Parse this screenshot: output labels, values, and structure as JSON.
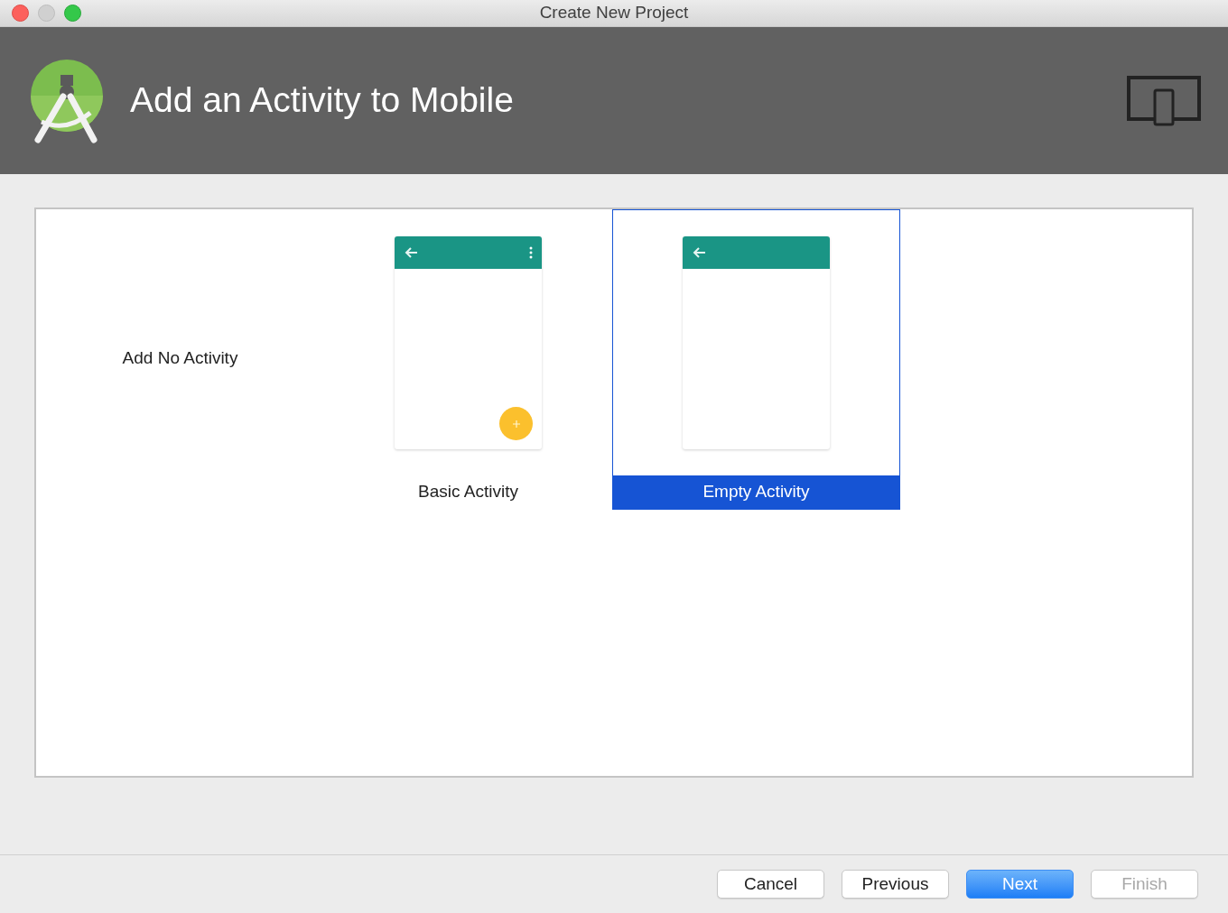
{
  "window": {
    "title": "Create New Project"
  },
  "header": {
    "title": "Add an Activity to Mobile"
  },
  "templates": [
    {
      "label": "Add No Activity",
      "kind": "none",
      "selected": false
    },
    {
      "label": "Basic Activity",
      "kind": "basic",
      "selected": false
    },
    {
      "label": "Empty Activity",
      "kind": "empty",
      "selected": true
    }
  ],
  "buttons": [
    {
      "label": "Cancel",
      "kind": "normal",
      "disabled": false
    },
    {
      "label": "Previous",
      "kind": "normal",
      "disabled": false
    },
    {
      "label": "Next",
      "kind": "primary",
      "disabled": false
    },
    {
      "label": "Finish",
      "kind": "normal",
      "disabled": true
    }
  ]
}
